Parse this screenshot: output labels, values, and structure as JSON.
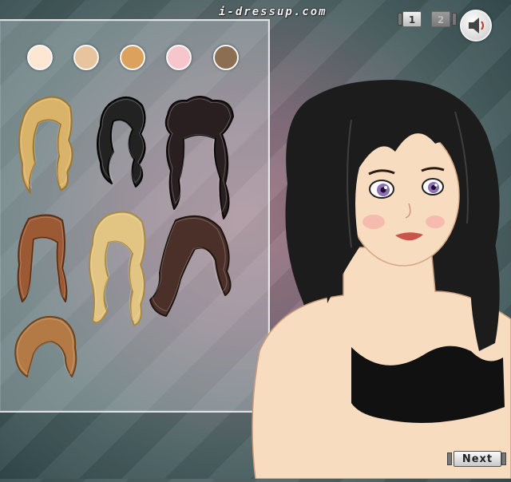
{
  "site": {
    "title": "i-dressup.com"
  },
  "page_controls": {
    "page1_label": "1",
    "page2_label": "2",
    "active_page": 1
  },
  "sound": {
    "icon": "speaker-icon"
  },
  "next_button": {
    "label": "Next"
  },
  "skin_tones": [
    {
      "name": "porcelain",
      "color": "#fde6d2"
    },
    {
      "name": "light-beige",
      "color": "#e7c49d"
    },
    {
      "name": "tan",
      "color": "#dda15e"
    },
    {
      "name": "pink",
      "color": "#f7c6cc"
    },
    {
      "name": "brown",
      "color": "#8c6e52"
    }
  ],
  "hairstyles": [
    {
      "id": "blonde-curly-bangs",
      "color": "#d9b36a",
      "dark": "#9c7630"
    },
    {
      "id": "black-wavy-long",
      "color": "#222222",
      "dark": "#000000"
    },
    {
      "id": "black-braided-updo",
      "color": "#2a1f20",
      "dark": "#0d0808"
    },
    {
      "id": "auburn-straight-long",
      "color": "#9b5a33",
      "dark": "#5a2e14"
    },
    {
      "id": "blonde-ringlets",
      "color": "#e2c483",
      "dark": "#a78a44"
    },
    {
      "id": "brunette-side-swept",
      "color": "#4a3028",
      "dark": "#21140f"
    },
    {
      "id": "caramel-short-bob",
      "color": "#b47a45",
      "dark": "#6d4420"
    }
  ],
  "character": {
    "hair_color": "#1c1c1c",
    "skin_color": "#f8dcc0",
    "eye_color": "#8c6fb4",
    "top_color": "#111111"
  }
}
